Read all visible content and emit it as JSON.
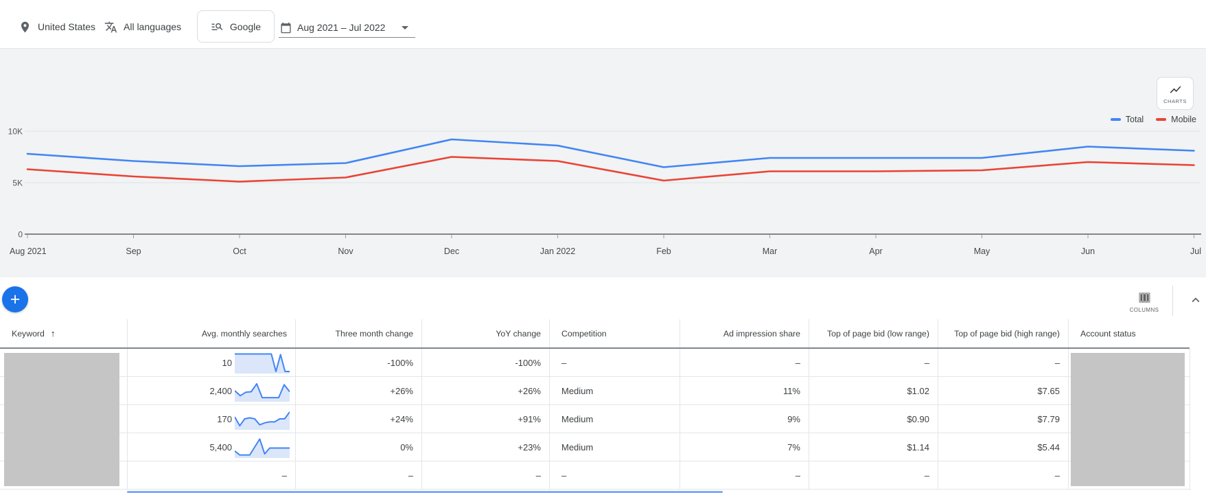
{
  "toolbar": {
    "location": "United States",
    "languages": "All languages",
    "network": "Google",
    "date_range": "Aug 2021 – Jul 2022"
  },
  "chart": {
    "charts_button_label": "CHARTS"
  },
  "chart_data": {
    "type": "line",
    "x": [
      "Aug 2021",
      "Sep",
      "Oct",
      "Nov",
      "Dec",
      "Jan 2022",
      "Feb",
      "Mar",
      "Apr",
      "May",
      "Jun",
      "Jul"
    ],
    "series": [
      {
        "name": "Total",
        "color": "#4285f4",
        "values": [
          7800,
          7100,
          6600,
          6900,
          9200,
          8600,
          6500,
          7400,
          7400,
          7400,
          8500,
          8100
        ]
      },
      {
        "name": "Mobile",
        "color": "#ea4335",
        "values": [
          6300,
          5600,
          5100,
          5500,
          7500,
          7100,
          5200,
          6100,
          6100,
          6200,
          7000,
          6700
        ]
      }
    ],
    "y_ticks": [
      {
        "value": 0,
        "label": "0"
      },
      {
        "value": 5000,
        "label": "5K"
      },
      {
        "value": 10000,
        "label": "10K"
      }
    ],
    "ylim": [
      0,
      10500
    ],
    "grid": "horizontal",
    "legend_position": "top-right"
  },
  "table": {
    "columns_button_label": "COLUMNS",
    "sort": {
      "column": "Keyword",
      "direction": "ascending"
    },
    "headers": [
      {
        "key": "keyword",
        "label": "Keyword"
      },
      {
        "key": "avg_monthly_searches",
        "label": "Avg. monthly searches"
      },
      {
        "key": "three_month_change",
        "label": "Three month change"
      },
      {
        "key": "yoy_change",
        "label": "YoY change"
      },
      {
        "key": "competition",
        "label": "Competition"
      },
      {
        "key": "ad_impression_share",
        "label": "Ad impression share"
      },
      {
        "key": "top_of_page_bid_low",
        "label": "Top of page bid (low range)"
      },
      {
        "key": "top_of_page_bid_high",
        "label": "Top of page bid (high range)"
      },
      {
        "key": "account_status",
        "label": "Account status"
      }
    ],
    "rows": [
      {
        "keyword": "",
        "avg_monthly_searches": "10",
        "sparkline": [
          0.93,
          0.93,
          0.93,
          0.93,
          0.93,
          0.93,
          0.93,
          0.93,
          0.93,
          0.05,
          0.9,
          0.05,
          0.05
        ],
        "three_month_change": "-100%",
        "yoy_change": "-100%",
        "competition": "–",
        "ad_impression_share": "–",
        "top_of_page_bid_low": "–",
        "top_of_page_bid_high": "–",
        "account_status": ""
      },
      {
        "keyword": "",
        "avg_monthly_searches": "2,400",
        "sparkline": [
          0.5,
          0.25,
          0.42,
          0.45,
          0.85,
          0.15,
          0.15,
          0.15,
          0.15,
          0.8,
          0.45
        ],
        "three_month_change": "+26%",
        "yoy_change": "+26%",
        "competition": "Medium",
        "ad_impression_share": "11%",
        "top_of_page_bid_low": "$1.02",
        "top_of_page_bid_high": "$7.65",
        "account_status": ""
      },
      {
        "keyword": "",
        "avg_monthly_searches": "170",
        "sparkline": [
          0.6,
          0.15,
          0.5,
          0.55,
          0.5,
          0.2,
          0.3,
          0.35,
          0.35,
          0.5,
          0.5,
          0.85
        ],
        "three_month_change": "+24%",
        "yoy_change": "+91%",
        "competition": "Medium",
        "ad_impression_share": "9%",
        "top_of_page_bid_low": "$0.90",
        "top_of_page_bid_high": "$7.79",
        "account_status": ""
      },
      {
        "keyword": "",
        "avg_monthly_searches": "5,400",
        "sparkline": [
          0.3,
          0.1,
          0.1,
          0.1,
          0.5,
          0.9,
          0.15,
          0.45,
          0.45,
          0.45,
          0.45,
          0.45
        ],
        "three_month_change": "0%",
        "yoy_change": "+23%",
        "competition": "Medium",
        "ad_impression_share": "7%",
        "top_of_page_bid_low": "$1.14",
        "top_of_page_bid_high": "$5.44",
        "account_status": ""
      },
      {
        "keyword": "",
        "avg_monthly_searches": "–",
        "sparkline": null,
        "three_month_change": "–",
        "yoy_change": "–",
        "competition": "–",
        "ad_impression_share": "–",
        "top_of_page_bid_low": "–",
        "top_of_page_bid_high": "–",
        "account_status": ""
      }
    ]
  }
}
